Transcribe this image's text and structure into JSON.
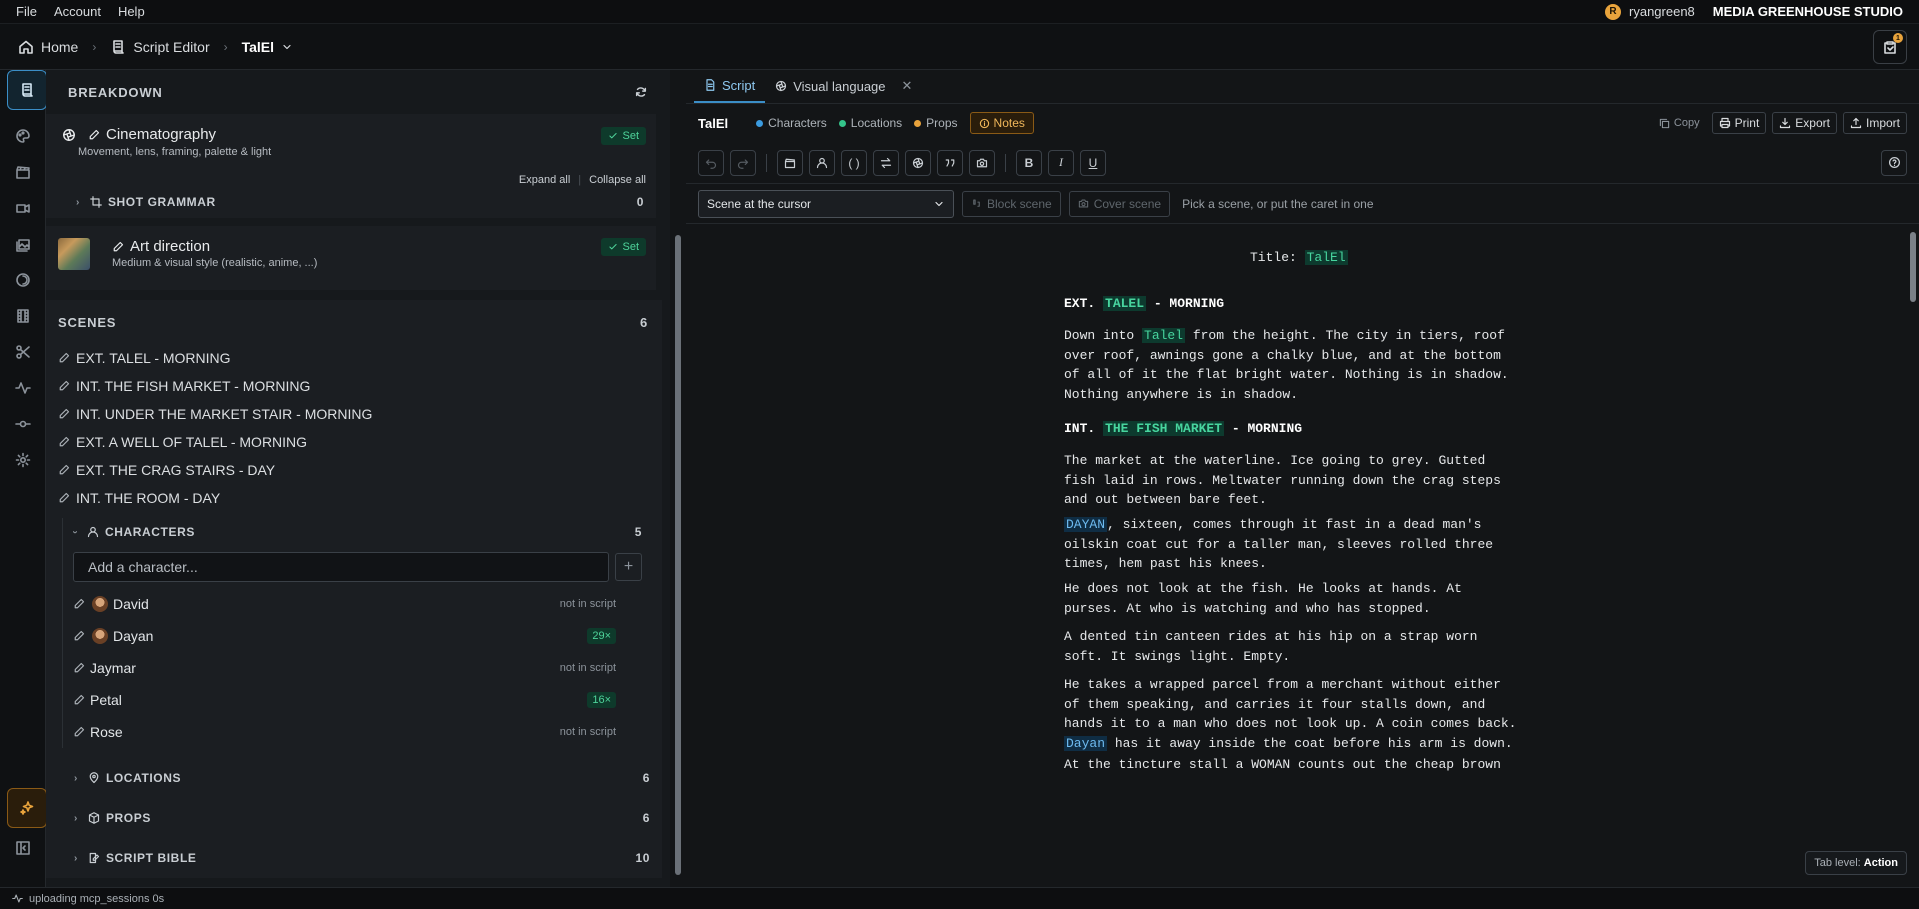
{
  "menu": {
    "items": [
      "File",
      "Account",
      "Help"
    ],
    "user": "ryangreen8",
    "user_initial": "R",
    "studio": "MEDIA GREENHOUSE STUDIO"
  },
  "breadcrumb": {
    "home": "Home",
    "editor": "Script Editor",
    "current": "TalEl",
    "notes_badge": "1"
  },
  "breakdown": {
    "title": "BREAKDOWN",
    "cinematography": {
      "title": "Cinematography",
      "subtitle": "Movement, lens, framing, palette & light",
      "status": "Set",
      "expand_all": "Expand all",
      "collapse_all": "Collapse all"
    },
    "shot_grammar": {
      "label": "SHOT GRAMMAR",
      "count": "0"
    },
    "art_direction": {
      "title": "Art direction",
      "subtitle": "Medium & visual style (realistic, anime, ...)",
      "status": "Set"
    }
  },
  "scenes": {
    "label": "SCENES",
    "count": "6",
    "items": [
      "EXT. TALEL - MORNING",
      "INT. THE FISH MARKET - MORNING",
      "INT. UNDER THE MARKET STAIR - MORNING",
      "EXT. A WELL OF TALEL - MORNING",
      "EXT. THE CRAG STAIRS - DAY",
      "INT. THE ROOM - DAY"
    ]
  },
  "characters": {
    "label": "CHARACTERS",
    "count": "5",
    "placeholder": "Add a character...",
    "items": [
      {
        "name": "David",
        "note": "not in script",
        "uses": ""
      },
      {
        "name": "Dayan",
        "note": "",
        "uses": "29×"
      },
      {
        "name": "Jaymar",
        "note": "not in script",
        "uses": ""
      },
      {
        "name": "Petal",
        "note": "",
        "uses": "16×"
      },
      {
        "name": "Rose",
        "note": "not in script",
        "uses": ""
      }
    ]
  },
  "locations": {
    "label": "LOCATIONS",
    "count": "6"
  },
  "props": {
    "label": "PROPS",
    "count": "6"
  },
  "script_bible": {
    "label": "SCRIPT BIBLE",
    "count": "10"
  },
  "tabs": {
    "script": "Script",
    "visual": "Visual language"
  },
  "docbar": {
    "name": "TalEl",
    "legend": [
      "Characters",
      "Locations",
      "Props"
    ],
    "legend_colors": [
      "#3b9be0",
      "#34c48a",
      "#e8a33c"
    ],
    "notes": "Notes",
    "copy": "Copy",
    "print": "Print",
    "export": "Export",
    "import": "Import"
  },
  "scenebar": {
    "selected": "Scene at the cursor",
    "block": "Block scene",
    "cover": "Cover scene",
    "hint": "Pick a scene, or put the caret in one"
  },
  "script": {
    "title_label": "Title: ",
    "title_value": "TalEl",
    "scene1": {
      "pre": "EXT. ",
      "loc": "TALEL",
      "post": " - MORNING"
    },
    "p1": [
      "Down into ",
      "Talel",
      " from the height. The city in tiers, roof"
    ],
    "p1_rest": [
      "over roof, awnings gone a chalky blue, and at the bottom",
      "of all of it the flat bright water. Nothing is in shadow.",
      "Nothing anywhere is in shadow."
    ],
    "scene2": {
      "pre": "INT. ",
      "loc": "THE FISH MARKET",
      "post": " - MORNING"
    },
    "p2": [
      "The market at the waterline. Ice going to grey. Gutted",
      "fish laid in rows. Meltwater running down the crag steps",
      "and out between bare feet."
    ],
    "p3_char": "DAYAN",
    "p3_first": ", sixteen, comes through it fast in a dead man's",
    "p3": [
      "oilskin coat cut for a taller man, sleeves rolled three",
      "times, hem past his knees."
    ],
    "p4": [
      "He does not look at the fish. He looks at hands. At",
      "purses. At who is watching and who has stopped."
    ],
    "p5": [
      "A dented tin canteen rides at his hip on a strap worn",
      "soft. It swings light. Empty."
    ],
    "p6": [
      "He takes a wrapped parcel from a merchant without either",
      "of them speaking, and carries it four stalls down, and",
      "hands it to a man who does not look up. A coin comes back."
    ],
    "p6_char": "Dayan",
    "p6_last": " has it away inside the coat before his arm is down.",
    "p7": "At the tincture stall a WOMAN counts out the cheap brown"
  },
  "tablevel": {
    "label": "Tab level: ",
    "value": "Action"
  },
  "status": {
    "text": "uploading mcp_sessions 0s"
  }
}
